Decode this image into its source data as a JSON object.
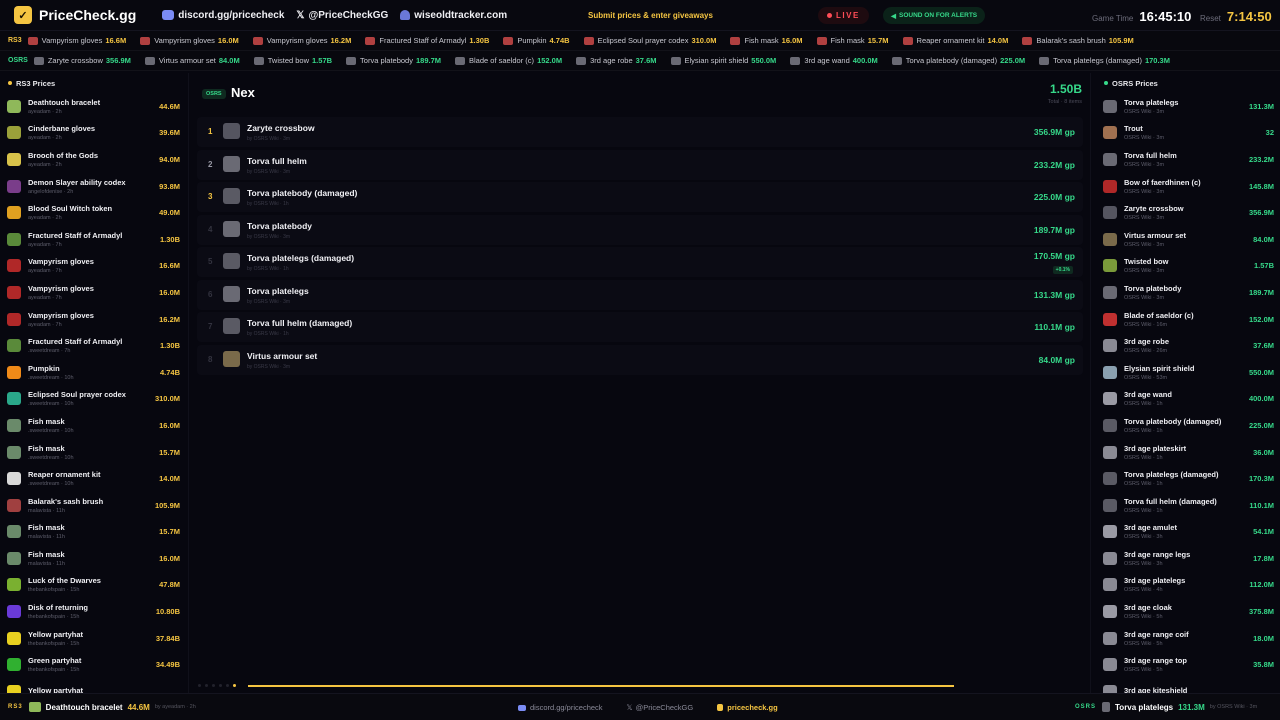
{
  "topbar": {
    "brand": "PriceCheck.gg",
    "links": [
      "discord.gg/pricecheck",
      "@PriceCheckGG",
      "wiseoldtracker.com"
    ],
    "cta": "Submit prices & enter giveaways",
    "live": "LIVE",
    "sound": "SOUND ON FOR ALERTS",
    "game_time_label": "Game Time",
    "game_time": "16:45:10",
    "reset_label": "Reset",
    "reset": "7:14:50"
  },
  "ticker_rs3": {
    "label": "RS3",
    "items": [
      {
        "name": "Vampyrism gloves",
        "value": "16.6M"
      },
      {
        "name": "Vampyrism gloves",
        "value": "16.0M"
      },
      {
        "name": "Vampyrism gloves",
        "value": "16.2M"
      },
      {
        "name": "Fractured Staff of Armadyl",
        "value": "1.30B"
      },
      {
        "name": "Pumpkin",
        "value": "4.74B"
      },
      {
        "name": "Eclipsed Soul prayer codex",
        "value": "310.0M"
      },
      {
        "name": "Fish mask",
        "value": "16.0M"
      },
      {
        "name": "Fish mask",
        "value": "15.7M"
      },
      {
        "name": "Reaper ornament kit",
        "value": "14.0M"
      },
      {
        "name": "Balarak's sash brush",
        "value": "105.9M"
      }
    ]
  },
  "ticker_osrs": {
    "label": "OSRS",
    "items": [
      {
        "name": "Zaryte crossbow",
        "value": "356.9M"
      },
      {
        "name": "Virtus armour set",
        "value": "84.0M"
      },
      {
        "name": "Twisted bow",
        "value": "1.57B"
      },
      {
        "name": "Torva platebody",
        "value": "189.7M"
      },
      {
        "name": "Blade of saeldor (c)",
        "value": "152.0M"
      },
      {
        "name": "3rd age robe",
        "value": "37.6M"
      },
      {
        "name": "Elysian spirit shield",
        "value": "550.0M"
      },
      {
        "name": "3rd age wand",
        "value": "400.0M"
      },
      {
        "name": "Torva platebody (damaged)",
        "value": "225.0M"
      },
      {
        "name": "Torva platelegs (damaged)",
        "value": "170.3M"
      }
    ]
  },
  "left": {
    "title": "RS3 Prices",
    "items": [
      {
        "name": "Deathtouch bracelet",
        "by": "ayeadam · 2h",
        "price": "44.6M",
        "color": "#8fb85a"
      },
      {
        "name": "Cinderbane gloves",
        "by": "ayeadam · 2h",
        "price": "39.6M",
        "color": "#9aa03a"
      },
      {
        "name": "Brooch of the Gods",
        "by": "ayeadam · 2h",
        "price": "94.0M",
        "color": "#d8c24a"
      },
      {
        "name": "Demon Slayer ability codex",
        "by": "angelofdenise · 2h",
        "price": "93.8M",
        "color": "#7a3d8a"
      },
      {
        "name": "Blood Soul Witch token",
        "by": "ayeadam · 2h",
        "price": "49.0M",
        "color": "#e0a020"
      },
      {
        "name": "Fractured Staff of Armadyl",
        "by": "ayeadam · 7h",
        "price": "1.30B",
        "color": "#5a8a3a"
      },
      {
        "name": "Vampyrism gloves",
        "by": "ayeadam · 7h",
        "price": "16.6M",
        "color": "#b02828"
      },
      {
        "name": "Vampyrism gloves",
        "by": "ayeadam · 7h",
        "price": "16.0M",
        "color": "#b02828"
      },
      {
        "name": "Vampyrism gloves",
        "by": "ayeadam · 7h",
        "price": "16.2M",
        "color": "#b02828"
      },
      {
        "name": "Fractured Staff of Armadyl",
        "by": ".sweetdream · 7h",
        "price": "1.30B",
        "color": "#5a8a3a"
      },
      {
        "name": "Pumpkin",
        "by": ".sweetdream · 10h",
        "price": "4.74B",
        "color": "#f08a18"
      },
      {
        "name": "Eclipsed Soul prayer codex",
        "by": ".sweetdream · 10h",
        "price": "310.0M",
        "color": "#2aa88a"
      },
      {
        "name": "Fish mask",
        "by": ".sweetdream · 10h",
        "price": "16.0M",
        "color": "#6a8a6a"
      },
      {
        "name": "Fish mask",
        "by": ".sweetdream · 10h",
        "price": "15.7M",
        "color": "#6a8a6a"
      },
      {
        "name": "Reaper ornament kit",
        "by": ".sweetdream · 10h",
        "price": "14.0M",
        "color": "#d8d8d8"
      },
      {
        "name": "Balarak's sash brush",
        "by": "malavista · 11h",
        "price": "105.9M",
        "color": "#a04040"
      },
      {
        "name": "Fish mask",
        "by": "malavista · 11h",
        "price": "15.7M",
        "color": "#6a8a6a"
      },
      {
        "name": "Fish mask",
        "by": "malavista · 11h",
        "price": "16.0M",
        "color": "#6a8a6a"
      },
      {
        "name": "Luck of the Dwarves",
        "by": "thebankofspain · 15h",
        "price": "47.8M",
        "color": "#7ab030"
      },
      {
        "name": "Disk of returning",
        "by": "thebankofspain · 15h",
        "price": "10.80B",
        "color": "#6a3ad8"
      },
      {
        "name": "Yellow partyhat",
        "by": "thebankofspain · 15h",
        "price": "37.84B",
        "color": "#e8d020"
      },
      {
        "name": "Green partyhat",
        "by": "thebankofspain · 15h",
        "price": "34.49B",
        "color": "#30b030"
      },
      {
        "name": "Yellow partyhat",
        "by": "",
        "price": "",
        "color": "#e8d020"
      }
    ]
  },
  "main": {
    "badge": "OSRS",
    "title": "Nex",
    "total": "1.50B",
    "total_sub": "Total · 8 items",
    "rows": [
      {
        "rank": "1",
        "name": "Zaryte crossbow",
        "sub": "by OSRS Wiki · 3m",
        "price": "356.9M gp",
        "change": "",
        "color": "#555560"
      },
      {
        "rank": "2",
        "name": "Torva full helm",
        "sub": "by OSRS Wiki · 3m",
        "price": "233.2M gp",
        "change": "",
        "color": "#6a6a74"
      },
      {
        "rank": "3",
        "name": "Torva platebody (damaged)",
        "sub": "by OSRS Wiki · 1h",
        "price": "225.0M gp",
        "change": "",
        "color": "#5a5a64"
      },
      {
        "rank": "4",
        "name": "Torva platebody",
        "sub": "by OSRS Wiki · 3m",
        "price": "189.7M gp",
        "change": "",
        "color": "#6a6a74"
      },
      {
        "rank": "5",
        "name": "Torva platelegs (damaged)",
        "sub": "by OSRS Wiki · 1h",
        "price": "170.5M gp",
        "change": "+0.1%",
        "color": "#5a5a64"
      },
      {
        "rank": "6",
        "name": "Torva platelegs",
        "sub": "by OSRS Wiki · 3m",
        "price": "131.3M gp",
        "change": "",
        "color": "#6a6a74"
      },
      {
        "rank": "7",
        "name": "Torva full helm (damaged)",
        "sub": "by OSRS Wiki · 1h",
        "price": "110.1M gp",
        "change": "",
        "color": "#5a5a64"
      },
      {
        "rank": "8",
        "name": "Virtus armour set",
        "sub": "by OSRS Wiki · 3m",
        "price": "84.0M gp",
        "change": "",
        "color": "#7a6a4a"
      }
    ]
  },
  "right": {
    "title": "OSRS Prices",
    "items": [
      {
        "name": "Torva platelegs",
        "by": "OSRS Wiki · 3m",
        "price": "131.3M",
        "color": "#6a6a74"
      },
      {
        "name": "Trout",
        "by": "OSRS Wiki · 3m",
        "price": "32",
        "color": "#a07050"
      },
      {
        "name": "Torva full helm",
        "by": "OSRS Wiki · 3m",
        "price": "233.2M",
        "color": "#6a6a74"
      },
      {
        "name": "Bow of faerdhinen (c)",
        "by": "OSRS Wiki · 3m",
        "price": "145.8M",
        "color": "#b02828"
      },
      {
        "name": "Zaryte crossbow",
        "by": "OSRS Wiki · 3m",
        "price": "356.9M",
        "color": "#555560"
      },
      {
        "name": "Virtus armour set",
        "by": "OSRS Wiki · 3m",
        "price": "84.0M",
        "color": "#7a6a4a"
      },
      {
        "name": "Twisted bow",
        "by": "OSRS Wiki · 3m",
        "price": "1.57B",
        "color": "#7a9a3a"
      },
      {
        "name": "Torva platebody",
        "by": "OSRS Wiki · 3m",
        "price": "189.7M",
        "color": "#6a6a74"
      },
      {
        "name": "Blade of saeldor (c)",
        "by": "OSRS Wiki · 16m",
        "price": "152.0M",
        "color": "#c03030"
      },
      {
        "name": "3rd age robe",
        "by": "OSRS Wiki · 26m",
        "price": "37.6M",
        "color": "#8a8a94"
      },
      {
        "name": "Elysian spirit shield",
        "by": "OSRS Wiki · 53m",
        "price": "550.0M",
        "color": "#8aa0b0"
      },
      {
        "name": "3rd age wand",
        "by": "OSRS Wiki · 1h",
        "price": "400.0M",
        "color": "#9a9aa4"
      },
      {
        "name": "Torva platebody (damaged)",
        "by": "OSRS Wiki · 1h",
        "price": "225.0M",
        "color": "#5a5a64"
      },
      {
        "name": "3rd age plateskirt",
        "by": "OSRS Wiki · 1h",
        "price": "36.0M",
        "color": "#8a8a94"
      },
      {
        "name": "Torva platelegs (damaged)",
        "by": "OSRS Wiki · 1h",
        "price": "170.3M",
        "color": "#5a5a64"
      },
      {
        "name": "Torva full helm (damaged)",
        "by": "OSRS Wiki · 1h",
        "price": "110.1M",
        "color": "#5a5a64"
      },
      {
        "name": "3rd age amulet",
        "by": "OSRS Wiki · 3h",
        "price": "54.1M",
        "color": "#9a9aa4"
      },
      {
        "name": "3rd age range legs",
        "by": "OSRS Wiki · 3h",
        "price": "17.8M",
        "color": "#8a8a94"
      },
      {
        "name": "3rd age platelegs",
        "by": "OSRS Wiki · 4h",
        "price": "112.0M",
        "color": "#8a8a94"
      },
      {
        "name": "3rd age cloak",
        "by": "OSRS Wiki · 5h",
        "price": "375.8M",
        "color": "#9a9aa4"
      },
      {
        "name": "3rd age range coif",
        "by": "OSRS Wiki · 5h",
        "price": "18.0M",
        "color": "#8a8a94"
      },
      {
        "name": "3rd age range top",
        "by": "OSRS Wiki · 5h",
        "price": "35.8M",
        "color": "#8a8a94"
      },
      {
        "name": "3rd age kiteshield",
        "by": "",
        "price": "",
        "color": "#8a8a94"
      }
    ]
  },
  "bottombar": {
    "rs3_tag": "RS3",
    "rs3_name": "Deathtouch bracelet",
    "rs3_price": "44.6M",
    "rs3_by": "by ayeadam · 2h",
    "links": [
      "discord.gg/pricecheck",
      "@PriceCheckGG",
      "pricecheck.gg"
    ],
    "osrs_tag": "OSRS",
    "osrs_name": "Torva platelegs",
    "osrs_price": "131.3M",
    "osrs_by": "by OSRS Wiki · 3m"
  },
  "colors": {
    "accent": "#f5c542",
    "green": "#36d98a",
    "live": "#ff4d57"
  }
}
